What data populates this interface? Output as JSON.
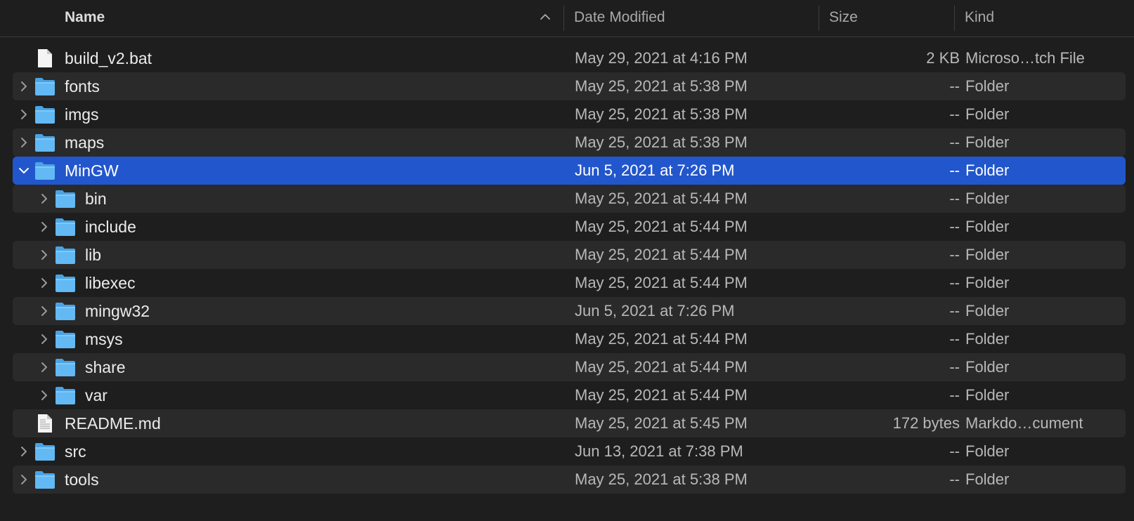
{
  "columns": {
    "name": "Name",
    "date_modified": "Date Modified",
    "size": "Size",
    "kind": "Kind"
  },
  "sort": {
    "column": "name",
    "direction": "ascending",
    "icon": "chevron-up-icon"
  },
  "colors": {
    "background": "#1e1e1e",
    "alt_row": "#2a2a2a",
    "selection": "#2256cc",
    "folder_blue": "#5ab4f0"
  },
  "items": [
    {
      "name": "build_v2.bat",
      "date": "May 29, 2021 at 4:16 PM",
      "size": "2 KB",
      "kind": "Microso…tch File",
      "type": "file",
      "depth": 0,
      "expanded": false,
      "selected": false,
      "icon": "document-icon"
    },
    {
      "name": "fonts",
      "date": "May 25, 2021 at 5:38 PM",
      "size": "--",
      "kind": "Folder",
      "type": "folder",
      "depth": 0,
      "expanded": false,
      "selected": false,
      "icon": "folder-icon"
    },
    {
      "name": "imgs",
      "date": "May 25, 2021 at 5:38 PM",
      "size": "--",
      "kind": "Folder",
      "type": "folder",
      "depth": 0,
      "expanded": false,
      "selected": false,
      "icon": "folder-icon"
    },
    {
      "name": "maps",
      "date": "May 25, 2021 at 5:38 PM",
      "size": "--",
      "kind": "Folder",
      "type": "folder",
      "depth": 0,
      "expanded": false,
      "selected": false,
      "icon": "folder-icon"
    },
    {
      "name": "MinGW",
      "date": "Jun 5, 2021 at 7:26 PM",
      "size": "--",
      "kind": "Folder",
      "type": "folder",
      "depth": 0,
      "expanded": true,
      "selected": true,
      "icon": "folder-icon"
    },
    {
      "name": "bin",
      "date": "May 25, 2021 at 5:44 PM",
      "size": "--",
      "kind": "Folder",
      "type": "folder",
      "depth": 1,
      "expanded": false,
      "selected": false,
      "icon": "folder-icon"
    },
    {
      "name": "include",
      "date": "May 25, 2021 at 5:44 PM",
      "size": "--",
      "kind": "Folder",
      "type": "folder",
      "depth": 1,
      "expanded": false,
      "selected": false,
      "icon": "folder-icon"
    },
    {
      "name": "lib",
      "date": "May 25, 2021 at 5:44 PM",
      "size": "--",
      "kind": "Folder",
      "type": "folder",
      "depth": 1,
      "expanded": false,
      "selected": false,
      "icon": "folder-icon"
    },
    {
      "name": "libexec",
      "date": "May 25, 2021 at 5:44 PM",
      "size": "--",
      "kind": "Folder",
      "type": "folder",
      "depth": 1,
      "expanded": false,
      "selected": false,
      "icon": "folder-icon"
    },
    {
      "name": "mingw32",
      "date": "Jun 5, 2021 at 7:26 PM",
      "size": "--",
      "kind": "Folder",
      "type": "folder",
      "depth": 1,
      "expanded": false,
      "selected": false,
      "icon": "folder-icon"
    },
    {
      "name": "msys",
      "date": "May 25, 2021 at 5:44 PM",
      "size": "--",
      "kind": "Folder",
      "type": "folder",
      "depth": 1,
      "expanded": false,
      "selected": false,
      "icon": "folder-icon"
    },
    {
      "name": "share",
      "date": "May 25, 2021 at 5:44 PM",
      "size": "--",
      "kind": "Folder",
      "type": "folder",
      "depth": 1,
      "expanded": false,
      "selected": false,
      "icon": "folder-icon"
    },
    {
      "name": "var",
      "date": "May 25, 2021 at 5:44 PM",
      "size": "--",
      "kind": "Folder",
      "type": "folder",
      "depth": 1,
      "expanded": false,
      "selected": false,
      "icon": "folder-icon"
    },
    {
      "name": "README.md",
      "date": "May 25, 2021 at 5:45 PM",
      "size": "172 bytes",
      "kind": "Markdo…cument",
      "type": "file",
      "depth": 0,
      "expanded": false,
      "selected": false,
      "icon": "text-document-icon"
    },
    {
      "name": "src",
      "date": "Jun 13, 2021 at 7:38 PM",
      "size": "--",
      "kind": "Folder",
      "type": "folder",
      "depth": 0,
      "expanded": false,
      "selected": false,
      "icon": "folder-icon"
    },
    {
      "name": "tools",
      "date": "May 25, 2021 at 5:38 PM",
      "size": "--",
      "kind": "Folder",
      "type": "folder",
      "depth": 0,
      "expanded": false,
      "selected": false,
      "icon": "folder-icon"
    }
  ]
}
